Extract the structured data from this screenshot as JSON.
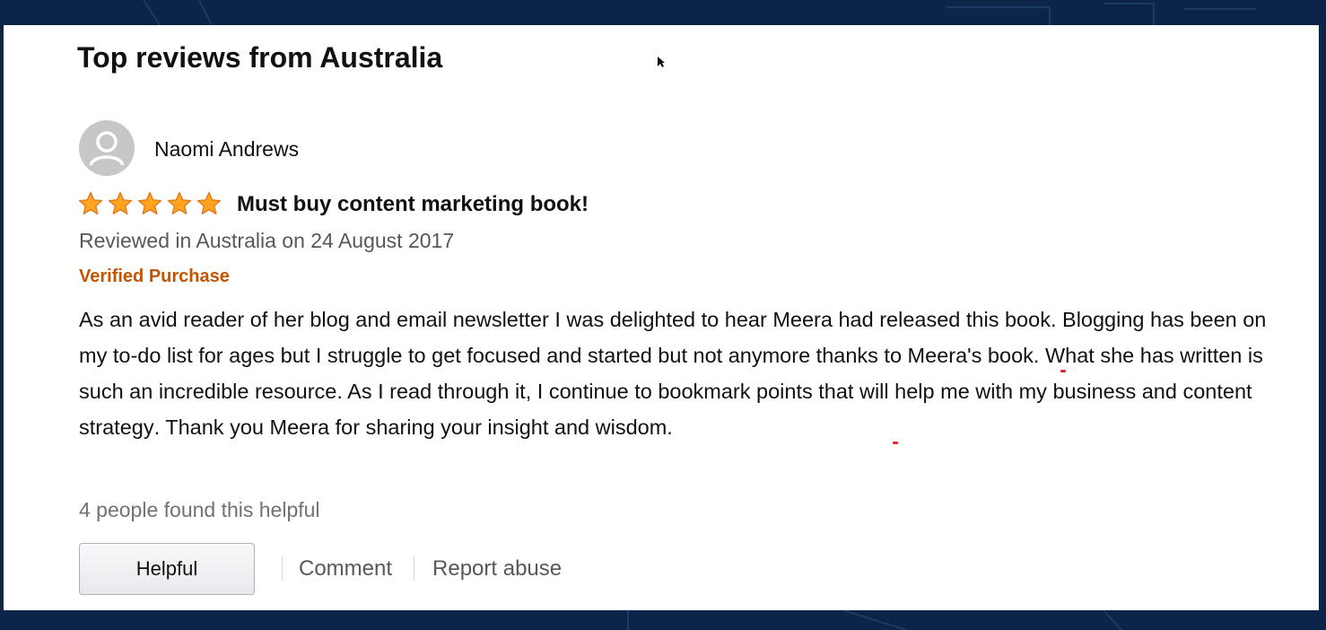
{
  "section": {
    "heading": "Top reviews from Australia"
  },
  "review": {
    "reviewer_name": "Naomi Andrews",
    "rating_stars": 5,
    "rating_max": 5,
    "title": "Must buy content marketing book!",
    "review_date": "Reviewed in Australia on 24 August 2017",
    "verified_label": "Verified Purchase",
    "body": {
      "part1": "As an avid reader of her blog and email newsletter I was delighted to hear Meera had released this book. ",
      "highlight1": "Blogging has been on my to-do list for ages but I struggle to get focused and started",
      "part2": " but not anymore thanks to Meera's book. What she has written is such an incredible resource. As I read through it, I continue to bookmark points that will ",
      "highlight2": "help me with my business and content strategy",
      "part3": ". Thank you Meera for sharing your insight and wisdom."
    },
    "helpful_count_text": "4 people found this helpful",
    "actions": {
      "helpful_label": "Helpful",
      "comment_label": "Comment",
      "report_label": "Report abuse"
    }
  },
  "colors": {
    "background": "#0b2447",
    "verified": "#c45500",
    "star": "#ffa41c",
    "highlight_underline": "#e0242a"
  },
  "icons": {
    "avatar": "user-silhouette-icon",
    "star": "star-filled-icon",
    "cursor": "mouse-pointer-icon"
  }
}
